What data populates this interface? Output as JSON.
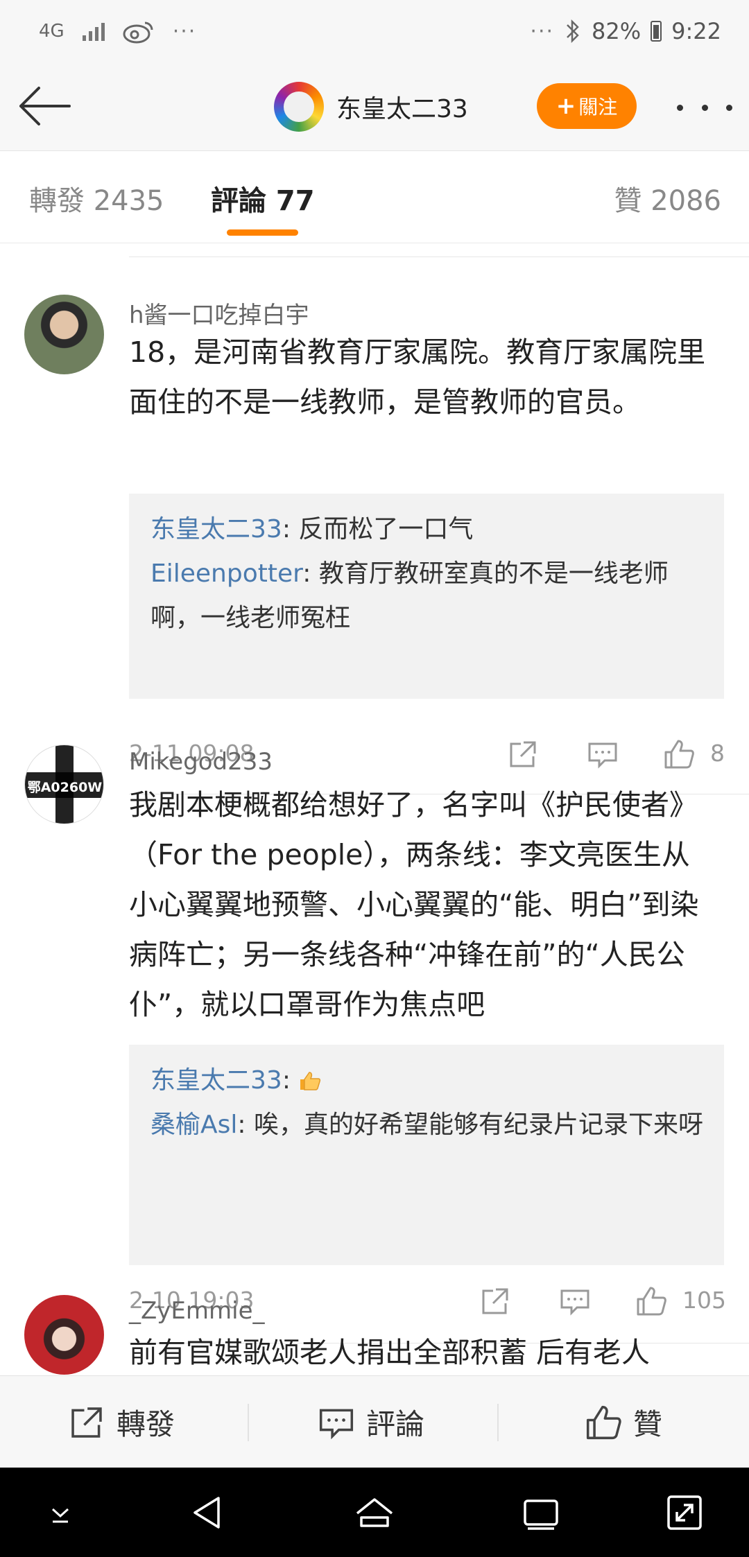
{
  "status_bar": {
    "network": "4G",
    "ellipsis": "···",
    "battery": "82%",
    "time": "9:22"
  },
  "header": {
    "author": "东皇太二33",
    "follow_label": "關注"
  },
  "tabs": [
    {
      "label": "轉發 2435"
    },
    {
      "label": "評論 77"
    },
    {
      "label": "贊 2086"
    }
  ],
  "comments": [
    {
      "user": "h酱一口吃掉白宇",
      "text": "18，是河南省教育厅家属院。教育厅家属院里面住的不是一线教师，是管教师的官员。",
      "replies": [
        {
          "name": "东皇太二33",
          "sep": ":",
          "text": " 反而松了一口气"
        },
        {
          "name": "Eileenpotter",
          "sep": ":",
          "text": " 教育厅教研室真的不是一线老师啊，一线老师冤枉"
        }
      ],
      "date": "2-11 09:08",
      "likes": "8"
    },
    {
      "user": "Mikegod233",
      "avatar_text": "鄂A0260W",
      "text": "我剧本梗概都给想好了，名字叫《护民使者》（For the people），两条线：李文亮医生从小心翼翼地预警、小心翼翼的“能、明白”到染病阵亡；另一条线各种“冲锋在前”的“人民公仆”，就以口罩哥作为焦点吧",
      "replies": [
        {
          "name": "东皇太二33",
          "sep": ":",
          "text": " "
        },
        {
          "name": "桑榆Asl",
          "sep": ":",
          "text": " 唉，真的好希望能够有纪录片记录下来呀"
        }
      ],
      "date": "2-10 19:03",
      "likes": "105"
    },
    {
      "user": "_ZyEmmie_",
      "text": "前有官媒歌颂老人捐出全部积蓄 后有老人"
    }
  ],
  "bottom_bar": {
    "repost": "轉發",
    "comment": "評論",
    "like": "贊"
  },
  "colors": {
    "accent": "#ff8200",
    "reply_name": "#4a7aae",
    "meta_gray": "#9a9a9a"
  }
}
